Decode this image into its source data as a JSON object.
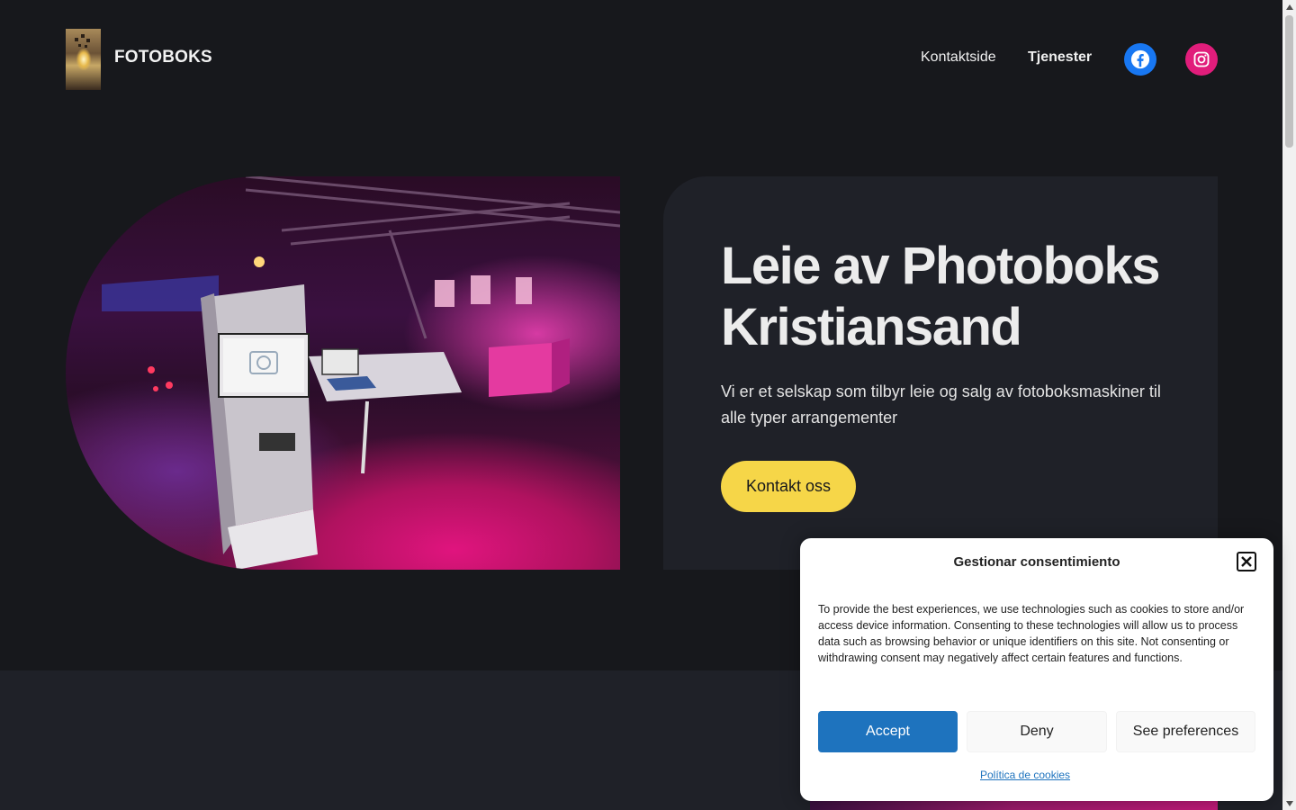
{
  "header": {
    "site_title": "FOTOBOKS",
    "nav": [
      {
        "label": "Kontaktside"
      },
      {
        "label": "Tjenester"
      }
    ],
    "social": [
      {
        "icon": "facebook-icon",
        "color": "#1877f2"
      },
      {
        "icon": "instagram-icon",
        "color": "#e11d7b"
      }
    ]
  },
  "hero": {
    "title": "Leie av Photoboks Kristiansand",
    "text": "Vi er et selskap som tilbyr leie og salg av fotoboksmaskiner til alle typer arrangementer",
    "cta_label": "Kontakt oss",
    "cta_color": "#f6d648"
  },
  "cookie_dialog": {
    "title": "Gestionar consentimiento",
    "body": "To provide the best experiences, we use technologies such as cookies to store and/or access device information. Consenting to these technologies will allow us to process data such as browsing behavior or unique identifiers on this site. Not consenting or withdrawing consent may negatively affect certain features and functions.",
    "accept_label": "Accept",
    "deny_label": "Deny",
    "preferences_label": "See preferences",
    "policy_link": "Política de cookies",
    "accent_color": "#1e73be"
  },
  "colors": {
    "background": "#17181c",
    "card": "#1f2128"
  }
}
